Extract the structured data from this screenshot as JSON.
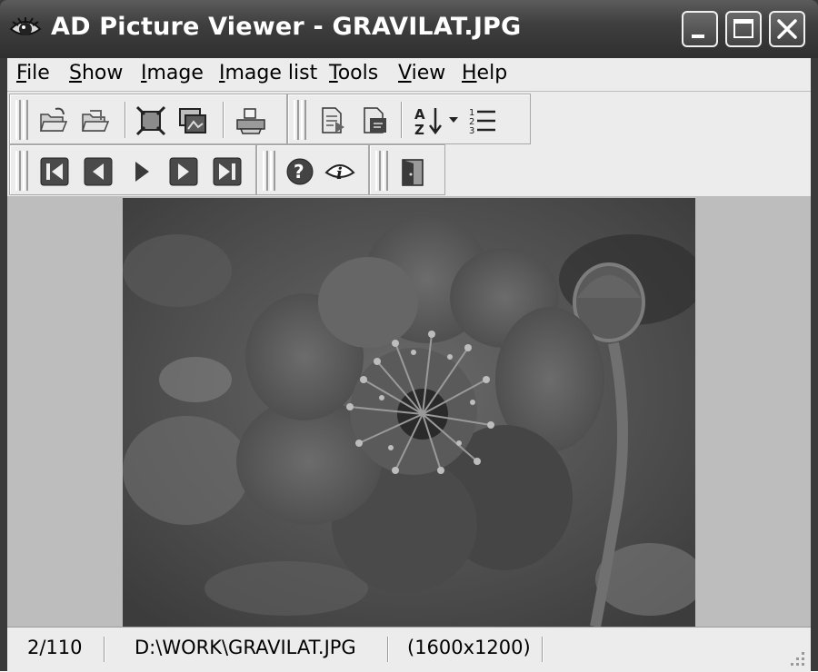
{
  "window": {
    "title": "AD Picture Viewer - GRAVILAT.JPG",
    "buttons": {
      "minimize": "minimize",
      "maximize": "maximize",
      "close": "close"
    }
  },
  "menu": [
    {
      "id": "file",
      "label": "File",
      "accel_index": 0
    },
    {
      "id": "show",
      "label": "Show",
      "accel_index": 0
    },
    {
      "id": "image",
      "label": "Image",
      "accel_index": 0
    },
    {
      "id": "image-list",
      "label": "Image list",
      "accel_index": 0
    },
    {
      "id": "tools",
      "label": "Tools",
      "accel_index": 0
    },
    {
      "id": "view",
      "label": "View",
      "accel_index": 0
    },
    {
      "id": "help",
      "label": "Help",
      "accel_index": 0
    }
  ],
  "toolbar": {
    "row1": [
      "open-folder-icon",
      "open-recent-icon",
      "fit-image-icon",
      "slideshow-icon",
      "print-icon",
      "copy-to-icon",
      "move-to-icon",
      "sort-az-icon",
      "sort-dropdown-icon",
      "numbered-list-icon"
    ],
    "row2": [
      "first-image-icon",
      "previous-image-icon",
      "play-icon",
      "next-image-icon",
      "last-image-icon",
      "help-icon",
      "info-icon",
      "exit-icon"
    ]
  },
  "image": {
    "filename": "GRAVILAT.JPG",
    "subject": "flower photo"
  },
  "status": {
    "position": "2/110",
    "path": "D:\\WORK\\GRAVILAT.JPG",
    "dimensions": "(1600x1200)"
  },
  "colors": {
    "titlebar": "#3f3f3f",
    "face": "#ececec",
    "viewer_bg": "#bdbdbd"
  }
}
